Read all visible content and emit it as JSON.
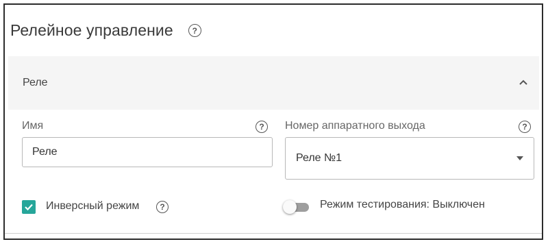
{
  "header": {
    "title": "Релейное управление",
    "help_icon": "help-circle-icon"
  },
  "section": {
    "title": "Реле",
    "expanded": true,
    "toggle_icon": "chevron-up-icon"
  },
  "name_field": {
    "label": "Имя",
    "value": "Реле",
    "help_icon": "help-circle-icon"
  },
  "output_field": {
    "label": "Номер аппаратного выхода",
    "value": "Реле №1",
    "help_icon": "help-circle-icon",
    "caret_icon": "caret-down-icon"
  },
  "inverse_mode": {
    "label": "Инверсный режим",
    "checked": true,
    "help_icon": "help-circle-icon"
  },
  "test_mode": {
    "label": "Режим тестирования: Выключен",
    "on": false
  },
  "colors": {
    "accent": "#26a69a",
    "section_bg": "#f5f5f5",
    "toggle_off": "#9e9e9e"
  }
}
